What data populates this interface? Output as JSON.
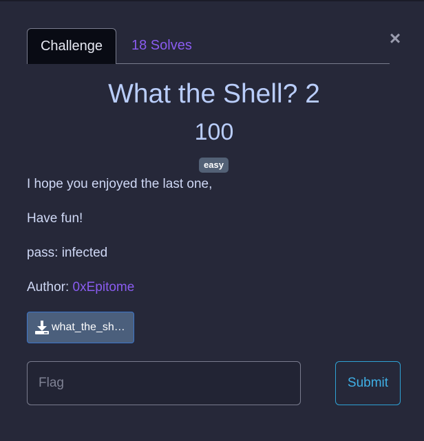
{
  "tabs": {
    "challenge": "Challenge",
    "solves": "18 Solves"
  },
  "close": "×",
  "challenge": {
    "title": "What the Shell? 2",
    "points": "100",
    "difficulty": "easy",
    "description": [
      "I hope you enjoyed the last one,",
      "Have fun!",
      "pass: infected"
    ],
    "author_label": "Author: ",
    "author_name": "0xEpitome"
  },
  "file": {
    "label": "what_the_sh…",
    "icon": "download-icon"
  },
  "flag": {
    "placeholder": "Flag",
    "value": ""
  },
  "submit": "Submit",
  "colors": {
    "background": "#262839",
    "accent_purple": "#8a5cf0",
    "title_blue": "#b9cdfa",
    "submit_blue": "#2fa3d6",
    "badge": "#536176"
  }
}
